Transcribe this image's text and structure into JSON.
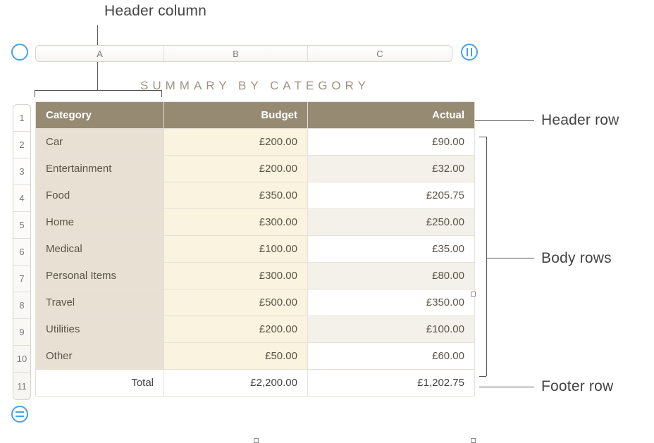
{
  "callouts": {
    "header_column": "Header column",
    "header_row": "Header row",
    "body_rows": "Body rows",
    "footer_row": "Footer row"
  },
  "title": "SUMMARY BY CATEGORY",
  "columns": {
    "a": "A",
    "b": "B",
    "c": "C"
  },
  "row_numbers": [
    "1",
    "2",
    "3",
    "4",
    "5",
    "6",
    "7",
    "8",
    "9",
    "10",
    "11"
  ],
  "header": {
    "category": "Category",
    "budget": "Budget",
    "actual": "Actual"
  },
  "rows": [
    {
      "category": "Car",
      "budget": "£200.00",
      "actual": "£90.00"
    },
    {
      "category": "Entertainment",
      "budget": "£200.00",
      "actual": "£32.00"
    },
    {
      "category": "Food",
      "budget": "£350.00",
      "actual": "£205.75"
    },
    {
      "category": "Home",
      "budget": "£300.00",
      "actual": "£250.00"
    },
    {
      "category": "Medical",
      "budget": "£100.00",
      "actual": "£35.00"
    },
    {
      "category": "Personal Items",
      "budget": "£300.00",
      "actual": "£80.00"
    },
    {
      "category": "Travel",
      "budget": "£500.00",
      "actual": "£350.00"
    },
    {
      "category": "Utilities",
      "budget": "£200.00",
      "actual": "£100.00"
    },
    {
      "category": "Other",
      "budget": "£50.00",
      "actual": "£60.00"
    }
  ],
  "footer": {
    "label": "Total",
    "budget": "£2,200.00",
    "actual": "£1,202.75"
  }
}
